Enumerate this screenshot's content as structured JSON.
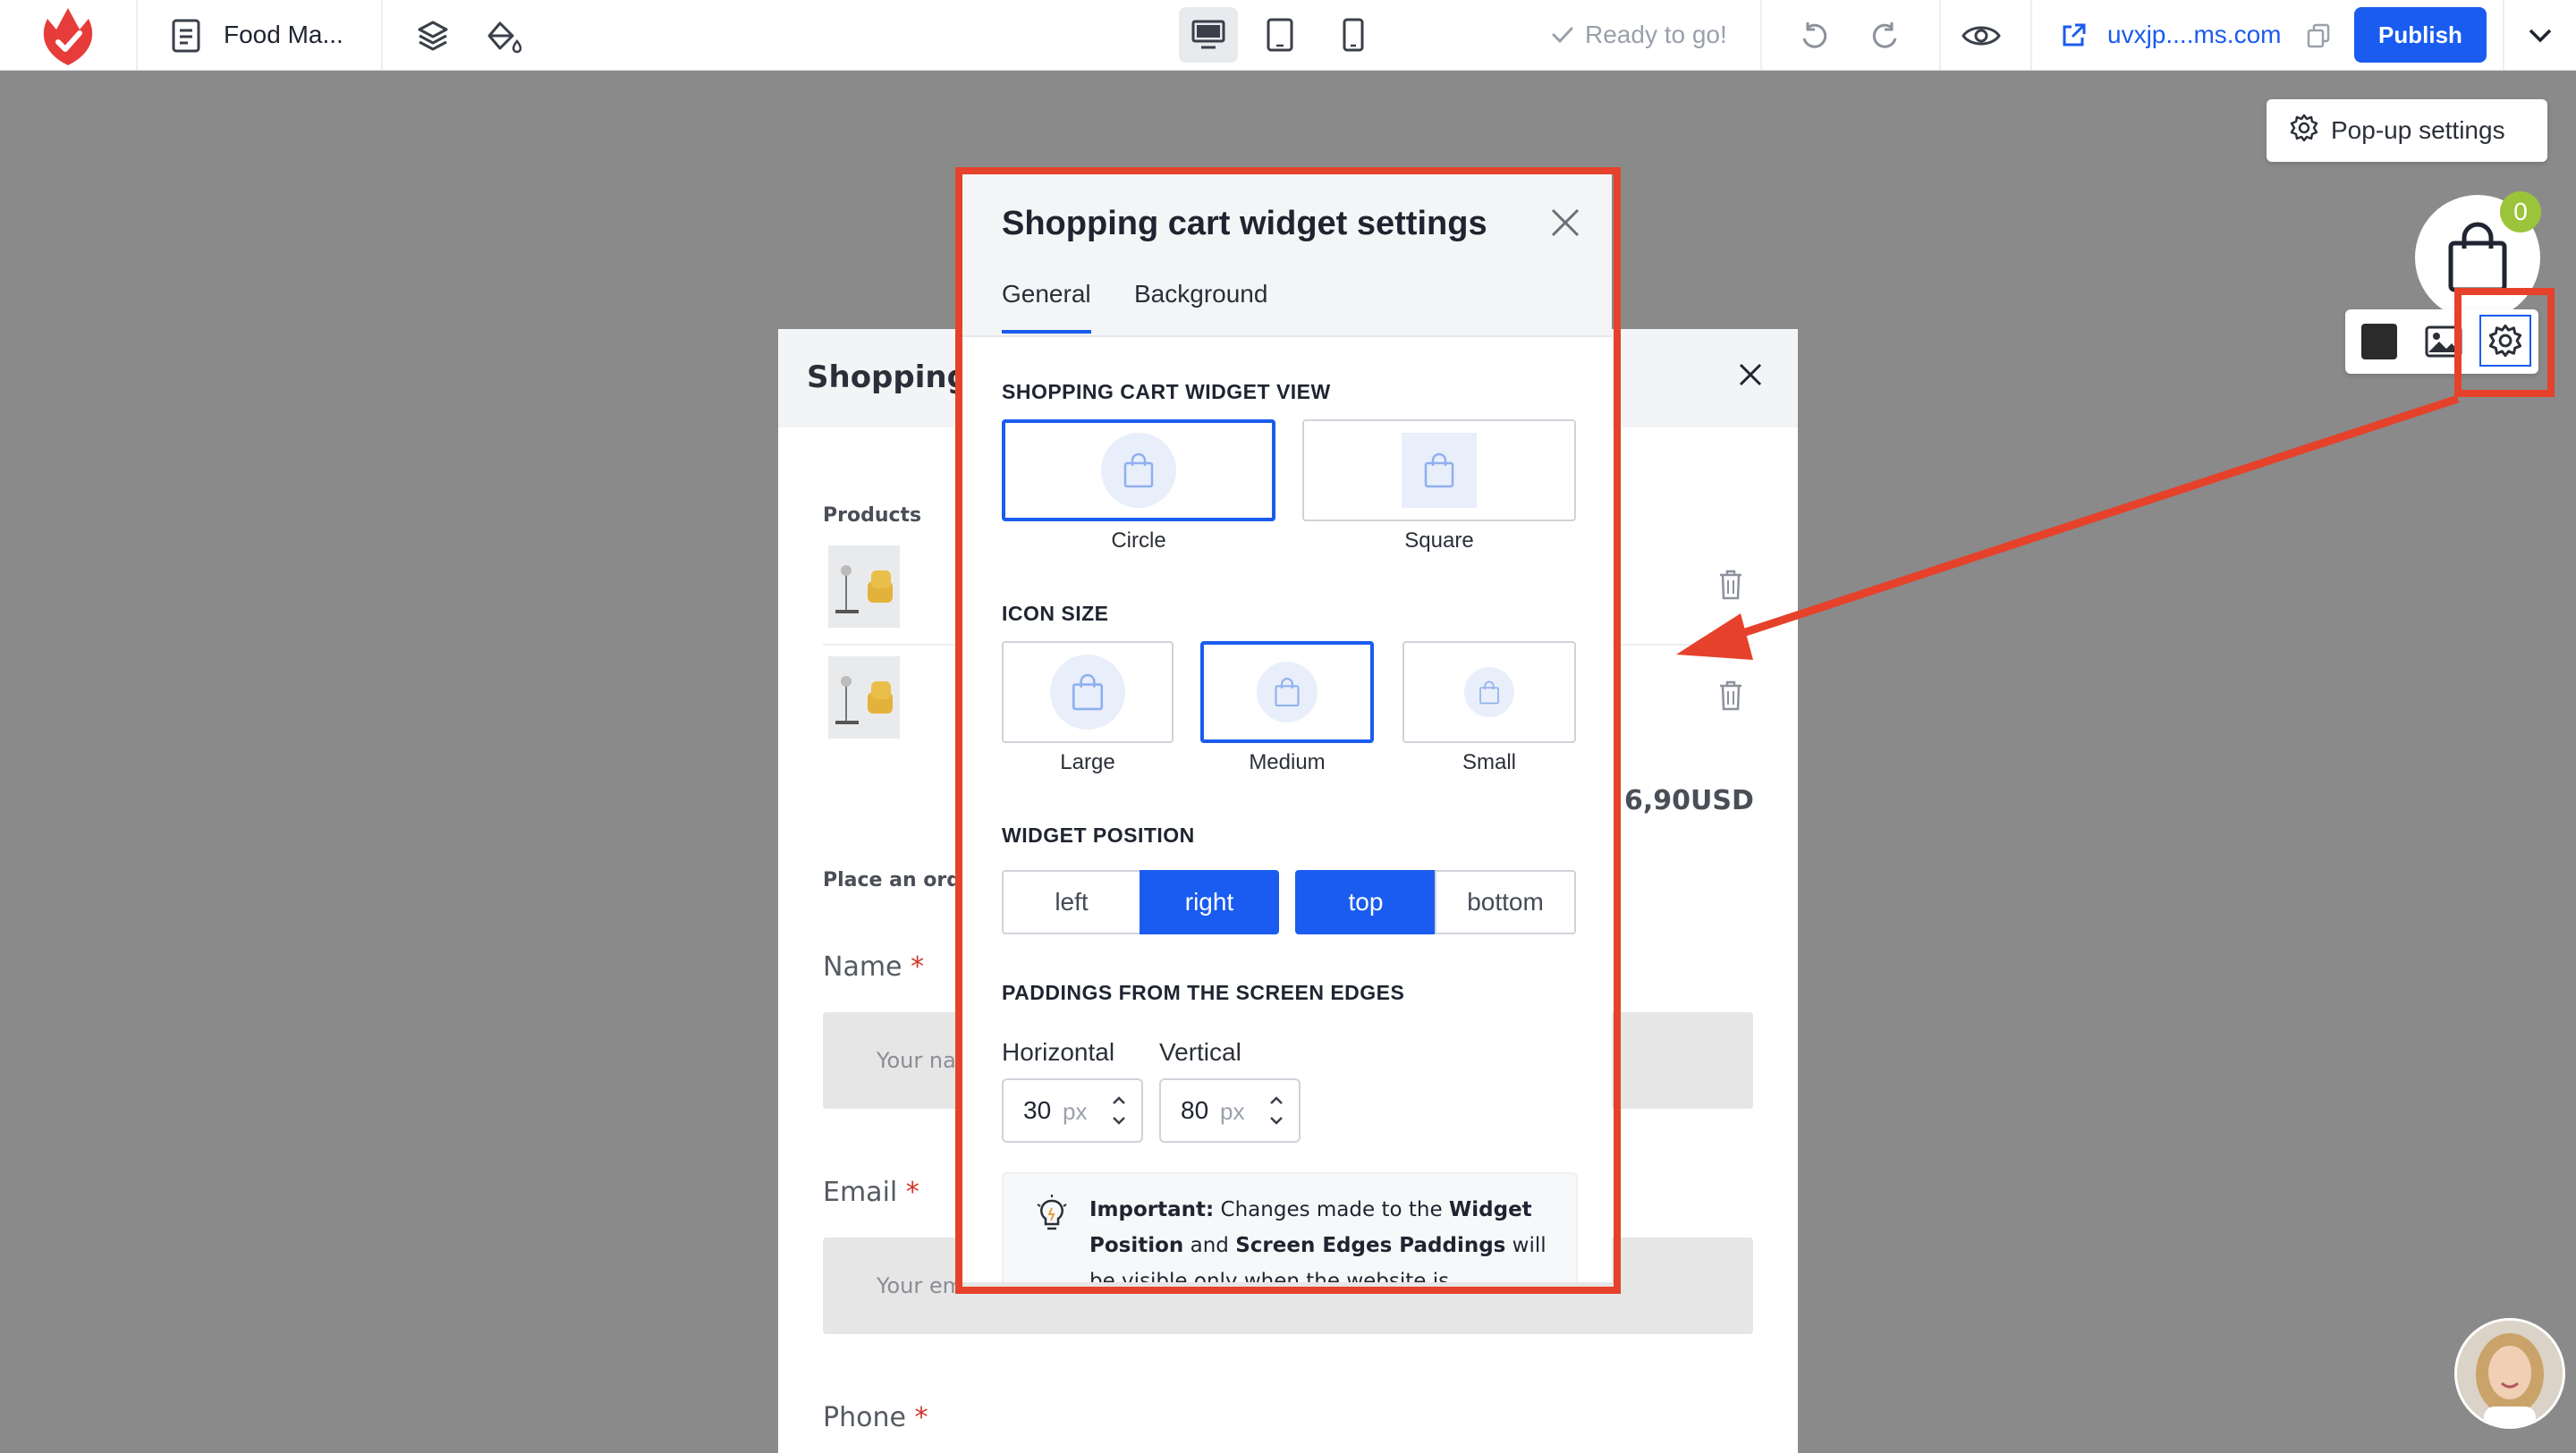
{
  "toolbar": {
    "page_name": "Food Ma...",
    "status": "Ready to go!",
    "site_url": "uvxjp....ms.com",
    "publish_label": "Publish"
  },
  "floating": {
    "popup_settings_label": "Pop-up settings",
    "cart_count": "0"
  },
  "cart_panel": {
    "title": "Shopping",
    "products_label": "Products",
    "total": "6,90USD",
    "place_order_label": "Place an orde",
    "fields": [
      {
        "label": "Name",
        "required": "*",
        "placeholder": "Your na"
      },
      {
        "label": "Email",
        "required": "*",
        "placeholder": "Your em"
      },
      {
        "label": "Phone",
        "required": "*"
      }
    ]
  },
  "modal": {
    "title": "Shopping cart widget settings",
    "tabs": [
      {
        "label": "General",
        "active": true
      },
      {
        "label": "Background",
        "active": false
      }
    ],
    "view_section": {
      "label": "SHOPPING CART WIDGET VIEW",
      "options": [
        {
          "label": "Circle",
          "selected": true
        },
        {
          "label": "Square",
          "selected": false
        }
      ]
    },
    "icon_size_section": {
      "label": "ICON SIZE",
      "options": [
        {
          "label": "Large",
          "selected": false
        },
        {
          "label": "Medium",
          "selected": true
        },
        {
          "label": "Small",
          "selected": false
        }
      ]
    },
    "position_section": {
      "label": "WIDGET POSITION",
      "horizontal": [
        {
          "label": "left",
          "selected": false
        },
        {
          "label": "right",
          "selected": true
        }
      ],
      "vertical": [
        {
          "label": "top",
          "selected": true
        },
        {
          "label": "bottom",
          "selected": false
        }
      ]
    },
    "paddings_section": {
      "label": "PADDINGS FROM THE SCREEN EDGES",
      "horizontal": {
        "label": "Horizontal",
        "value": "30",
        "unit": "px"
      },
      "vertical": {
        "label": "Vertical",
        "value": "80",
        "unit": "px"
      }
    },
    "notice": {
      "bold_lead": "Important:",
      "text_1": " Changes made to the ",
      "bold_1": "Widget Position",
      "text_2": " and ",
      "bold_2": "Screen Edges Paddings",
      "text_3": " will be visible only when the website is Published"
    }
  },
  "colors": {
    "accent": "#1a5cf0",
    "highlight_red": "#e6412a",
    "badge_green": "#9bc43b",
    "overlay_gray": "#8a8a8a"
  }
}
